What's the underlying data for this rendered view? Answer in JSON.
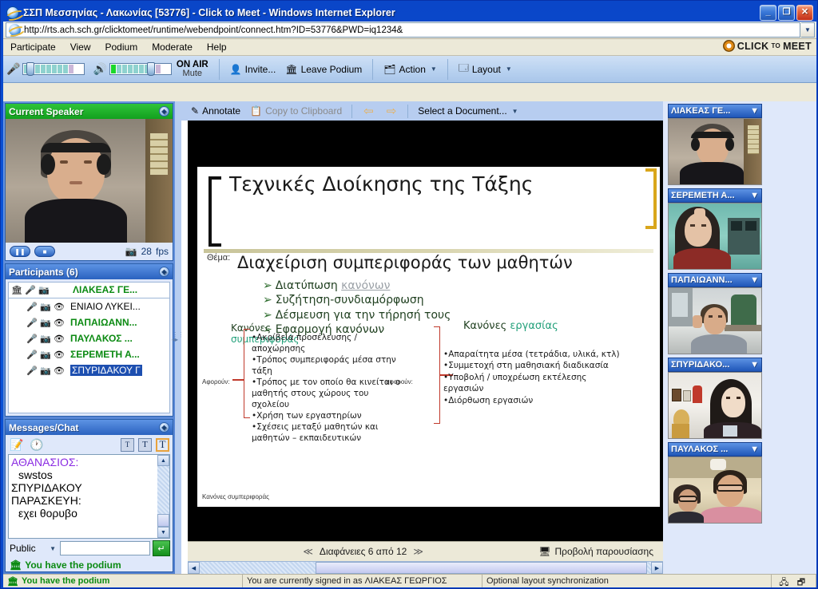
{
  "window": {
    "title": "ΣΣΠ Μεσσηνίας - Λακωνίας [53776] - Click to Meet - Windows Internet Explorer",
    "minimize": "_",
    "maximize": "❐",
    "close": "✕"
  },
  "address": {
    "url": "http://rts.ach.sch.gr/clicktomeet/runtime/webendpoint/connect.htm?ID=53776&PWD=iq1234&",
    "dropdown": "▼"
  },
  "menubar": {
    "items": [
      "Participate",
      "View",
      "Podium",
      "Moderate",
      "Help"
    ],
    "brand_main": "CLICK",
    "brand_to": "TO",
    "brand_meet": "MEET"
  },
  "toolbar": {
    "on_air": "ON AIR",
    "mute": "Mute",
    "invite": "Invite...",
    "leave_podium": "Leave Podium",
    "action": "Action",
    "layout": "Layout",
    "caret": "▼"
  },
  "current_speaker": {
    "title": "Current Speaker",
    "fps": "28",
    "fps_unit": "fps",
    "pause": "❚❚",
    "stop": "■",
    "expand": "◈"
  },
  "participants": {
    "title": "Participants (6)",
    "expand": "◈",
    "rows": [
      {
        "name": "ΛΙΑΚΕΑΣ ΓΕ...",
        "style": "host"
      },
      {
        "name": "ΕΝΙΑΙΟ ΛΥΚΕΙ...",
        "style": "black"
      },
      {
        "name": "ΠΑΠΑΙΩΑΝΝ...",
        "style": "green"
      },
      {
        "name": "ΠΑΥΛΑΚΟΣ ...",
        "style": "green"
      },
      {
        "name": "ΣΕΡΕΜΕΤΗ Α...",
        "style": "green"
      },
      {
        "name": "ΣΠΥΡΙΔΑΚΟΥ Γ",
        "style": "selected"
      }
    ]
  },
  "chat": {
    "title": "Messages/Chat",
    "expand": "◈",
    "tools": {
      "clear": "clear-icon",
      "history": "history-icon",
      "t_small": "T",
      "t_medium": "T",
      "t_large": "T"
    },
    "log": [
      {
        "speaker": "ΑΘΑΝΑΣΙΟΣ:",
        "speaker_color": "purple",
        "message": "swstos"
      },
      {
        "speaker": "ΣΠΥΡΙΔΑΚΟΥ ΠΑΡΑΣΚΕΥΗ:",
        "speaker_color": "black",
        "message": "εχει θορυβο"
      }
    ],
    "scope": "Public",
    "scope_caret": "▼",
    "input_value": "",
    "send": "↵"
  },
  "podium_status": "You have the podium",
  "doc_toolbar": {
    "annotate": "Annotate",
    "copy_to_clipboard": "Copy to Clipboard",
    "back": "⇦",
    "forward": "⇨",
    "select_document": "Select a Document...",
    "caret": "▼"
  },
  "slide": {
    "title": "Τεχνικές Διοίκησης της Τάξης",
    "thema_label": "Θέμα:",
    "subtitle": "Διαχείριση συμπεριφοράς των μαθητών",
    "bullets": [
      {
        "pre": "Διατύπωση ",
        "link": "κανόνων",
        "post": ""
      },
      {
        "pre": "Συζήτηση-συνδιαμόρφωση",
        "link": "",
        "post": ""
      },
      {
        "pre": "Δέσμευση για την τήρησή τους",
        "link": "",
        "post": ""
      },
      {
        "pre": "Εφαρμογή κανόνων",
        "link": "",
        "post": ""
      }
    ],
    "bullet_marker": "➢",
    "left_group_label_1": "Κανόνες",
    "left_group_label_2": "συμπεριφοράς",
    "right_group_label_1": "Κανόνες ",
    "right_group_label_2": "εργασίας",
    "aforoun_left": "Αφορούν:",
    "aforoun_right": "αφορούν:",
    "left_items": [
      "Ακρίβεια προσέλευσης / αποχώρησης",
      "Τρόπος συμπεριφοράς μέσα στην τάξη",
      "Τρόπος με τον οποίο θα κινείται ο μαθητής στους χώρους του σχολείου",
      "Χρήση των εργαστηρίων",
      "Σχέσεις μεταξύ μαθητών και μαθητών – εκπαιδευτικών"
    ],
    "right_items": [
      "Απαραίτητα μέσα (τετράδια, υλικά, κτλ)",
      "Συμμετοχή στη μαθησιακή διαδικασία",
      "Υποβολή / υποχρέωση εκτέλεσης εργασιών",
      "Διόρθωση εργασιών"
    ],
    "footnote": "Κανόνες συμπεριφοράς",
    "bullet_dot": "•"
  },
  "doc_status": {
    "prev": "≪",
    "slide_counter": "Διαφάνειες 6 από 12",
    "next": "≫",
    "present": "Προβολή παρουσίασης"
  },
  "video_thumbs": [
    {
      "label": "ΛΙΑΚΕΑΣ ΓΕ...",
      "caret": "▼"
    },
    {
      "label": "ΣΕΡΕΜΕΤΗ Α...",
      "caret": "▼"
    },
    {
      "label": "ΠΑΠΑΙΩΑΝΝ...",
      "caret": "▼"
    },
    {
      "label": "ΣΠΥΡΙΔΑΚΟ...",
      "caret": "▼"
    },
    {
      "label": "ΠΑΥΛΑΚΟΣ ...",
      "caret": "▼"
    }
  ],
  "statusbar": {
    "podium": "You have the podium",
    "signed_in": "You are currently signed in as ΛΙΑΚΕΑΣ ΓΕΩΡΓΙΟΣ",
    "sync": "Optional layout synchronization"
  },
  "colors": {
    "titlebar_blue": "#0a46c8",
    "panel_green": "#12a01e",
    "panel_blue": "#2a62bf",
    "accent_gold": "#d9a61b",
    "slide_red": "#c0392b",
    "status_green": "#0b8a12"
  }
}
